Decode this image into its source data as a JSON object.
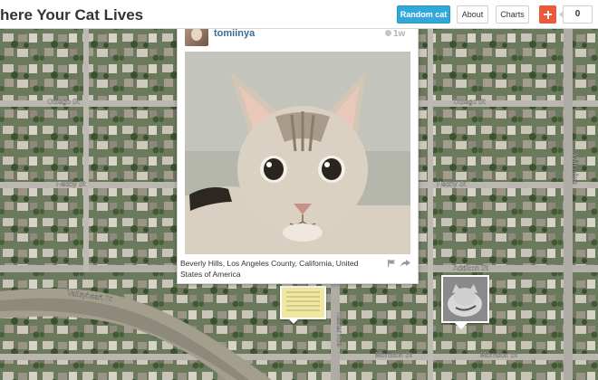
{
  "header": {
    "site_title": "here Your Cat Lives",
    "random_cat_label": "Random cat",
    "about_label": "About",
    "charts_label": "Charts",
    "add_icon": "plus-icon",
    "count": "0",
    "colors": {
      "random_button": "#31a8d9",
      "add_button": "#ea5a3a"
    }
  },
  "post": {
    "username": "tomiinya",
    "time": "1w",
    "location": "Beverly Hills, Los Angeles County, California, United States of America",
    "icons": [
      "clock-icon",
      "flag-icon",
      "share-icon"
    ]
  },
  "map": {
    "streets": [
      {
        "name": "Otsego St",
        "label": "Otsego St"
      },
      {
        "name": "Hesby St",
        "label": "Hesby St"
      },
      {
        "name": "Addison St",
        "label": "Addison St"
      },
      {
        "name": "Valley Heart Dr",
        "label": "Valleyheart Dr"
      },
      {
        "name": "Morrison St",
        "label": "Morrison St"
      },
      {
        "name": "Willis Ave",
        "label": "Willis Ave"
      },
      {
        "name": "Kester Ave",
        "label": "Kester Ave"
      }
    ]
  }
}
